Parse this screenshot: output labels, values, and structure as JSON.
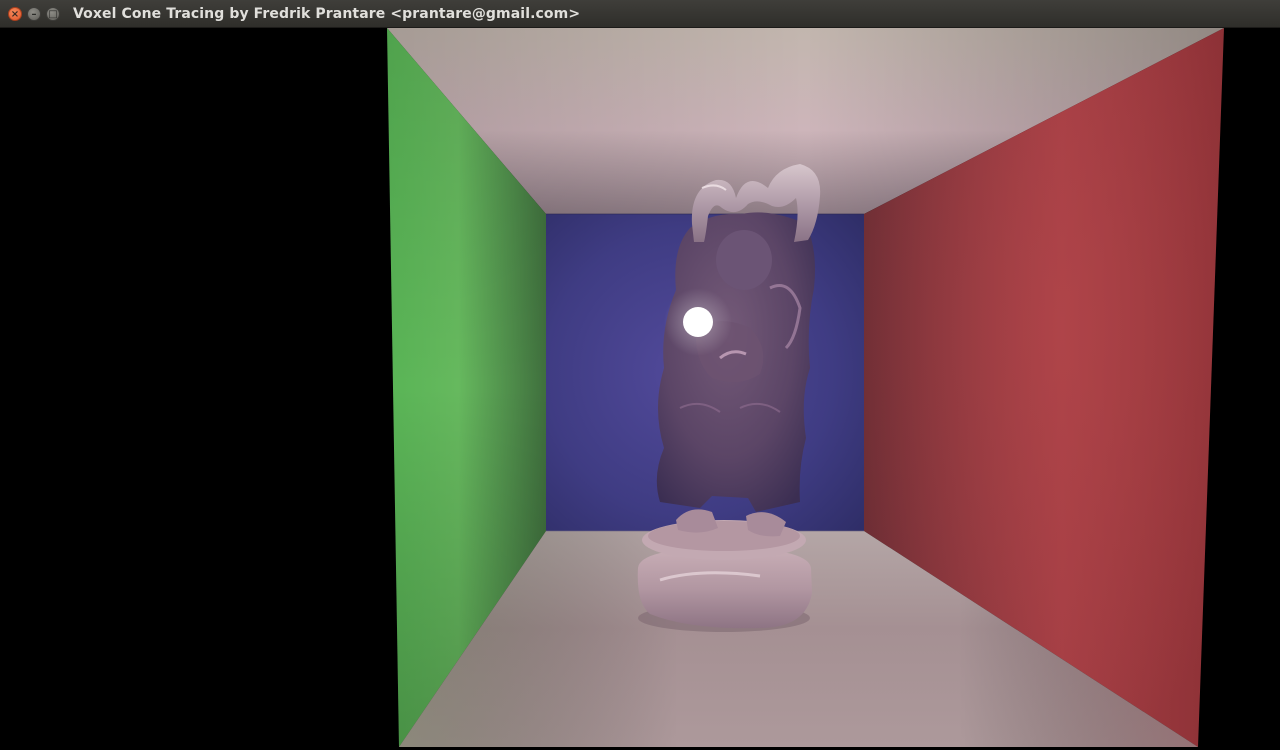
{
  "window": {
    "title": "Voxel Cone Tracing by Fredrik Prantare <prantare@gmail.com>",
    "controls": {
      "close_icon": "close-icon",
      "minimize_icon": "minimize-icon",
      "maximize_icon": "maximize-icon",
      "close_glyph": "×",
      "minimize_glyph": "–",
      "maximize_glyph": "□"
    }
  },
  "scene": {
    "name": "cornell-box",
    "colors": {
      "left_wall": "#5fb35a",
      "right_wall": "#a23e42",
      "back_wall": "#3f3d86",
      "ceiling": "#cbb4b8",
      "floor": "#a89396",
      "statue": "#5e4766",
      "light": "#ffffff",
      "background": "#000000"
    }
  },
  "status": {
    "text": ""
  }
}
